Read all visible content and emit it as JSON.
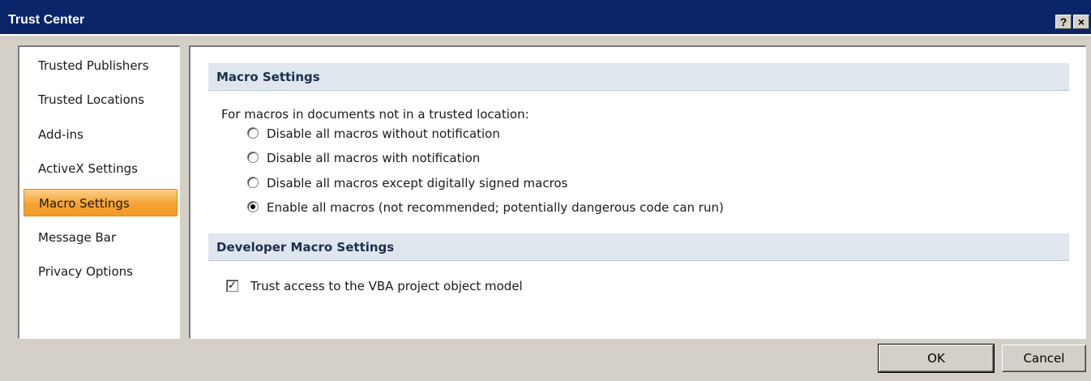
{
  "window": {
    "title": "Trust Center",
    "help_label": "?",
    "close_label": "×"
  },
  "nav": {
    "items": [
      {
        "label": "Trusted Publishers"
      },
      {
        "label": "Trusted Locations"
      },
      {
        "label": "Add-ins"
      },
      {
        "label": "ActiveX Settings"
      },
      {
        "label": "Macro Settings",
        "selected": true
      },
      {
        "label": "Message Bar"
      },
      {
        "label": "Privacy Options"
      }
    ]
  },
  "macro": {
    "header": "Macro Settings",
    "intro": "For macros in documents not in a trusted location:",
    "options": [
      {
        "label": "Disable all macros without notification",
        "selected": false
      },
      {
        "label": "Disable all macros with notification",
        "selected": false
      },
      {
        "label": "Disable all macros except digitally signed macros",
        "selected": false
      },
      {
        "label": "Enable all macros (not recommended; potentially dangerous code can run)",
        "selected": true
      }
    ]
  },
  "developer": {
    "header": "Developer Macro Settings",
    "vba_label": "Trust access to the VBA project object model",
    "vba_checked": true
  },
  "footer": {
    "ok_label": "OK",
    "cancel_label": "Cancel"
  },
  "colors": {
    "titlebar": "#0a246a",
    "selection": "#f4a233",
    "section_header": "#dfe6ee"
  }
}
